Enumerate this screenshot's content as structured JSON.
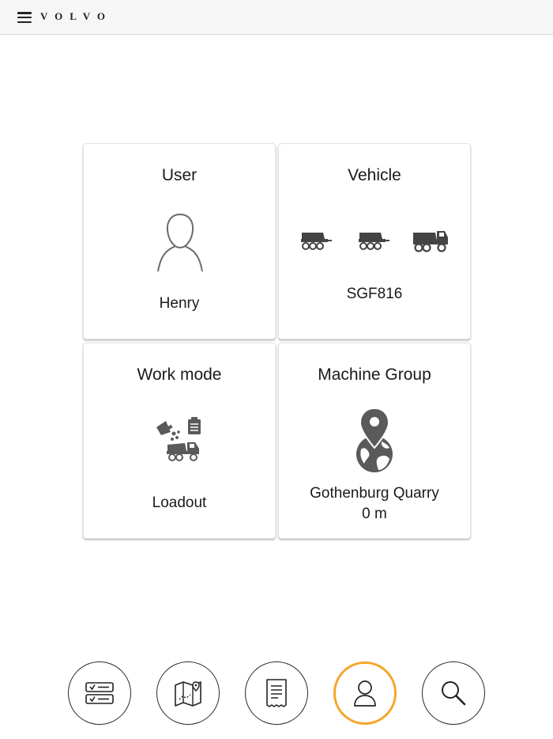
{
  "header": {
    "brand": "VOLVO",
    "menu_icon": "hamburger-menu-icon"
  },
  "cards": {
    "user": {
      "title": "User",
      "value": "Henry",
      "icon": "user-silhouette-icon"
    },
    "vehicle": {
      "title": "Vehicle",
      "value": "SGF816",
      "icons": [
        "articulated-hauler-icon",
        "articulated-hauler-icon",
        "dump-truck-icon"
      ]
    },
    "work_mode": {
      "title": "Work mode",
      "value": "Loadout",
      "icon": "loadout-icon"
    },
    "machine_group": {
      "title": "Machine Group",
      "value": "Gothenburg Quarry",
      "distance": "0 m",
      "icon": "location-globe-icon"
    }
  },
  "bottom_nav": {
    "items": [
      {
        "name": "tasks",
        "icon": "checklist-icon",
        "active": false
      },
      {
        "name": "map",
        "icon": "map-icon",
        "active": false
      },
      {
        "name": "receipt",
        "icon": "receipt-icon",
        "active": false
      },
      {
        "name": "profile",
        "icon": "user-icon",
        "active": true
      },
      {
        "name": "search",
        "icon": "search-icon",
        "active": false
      }
    ]
  },
  "colors": {
    "active_accent": "#f5a52a",
    "icon_gray": "#6b6b6b",
    "header_bg": "#f6f6f6"
  }
}
